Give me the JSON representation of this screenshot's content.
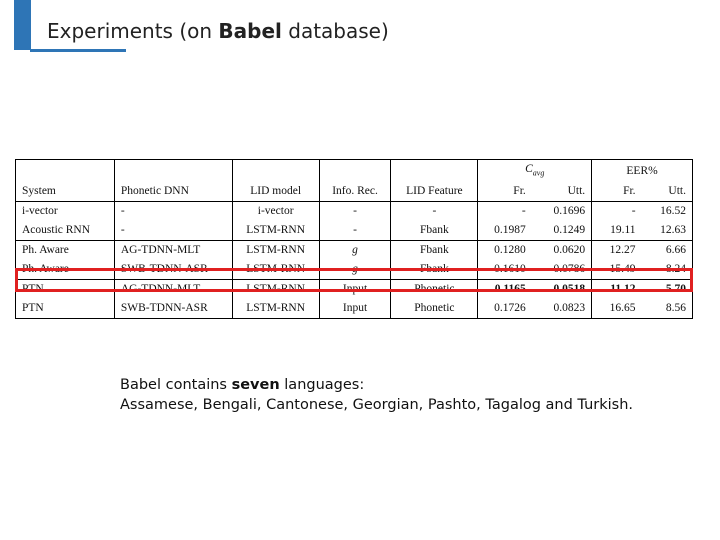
{
  "title": {
    "prefix": "Experiments (on ",
    "bold": "Babel",
    "suffix": " database)"
  },
  "colors": {
    "accent": "#2e75b6",
    "highlight": "#e02020"
  },
  "table": {
    "group_headers": {
      "cavg": "C",
      "cavg_sub": "avg",
      "eer": "EER%"
    },
    "headers": [
      "System",
      "Phonetic DNN",
      "LID model",
      "Info. Rec.",
      "LID Feature",
      "Fr.",
      "Utt.",
      "Fr.",
      "Utt."
    ],
    "rows": [
      [
        "i-vector",
        "-",
        "i-vector",
        "-",
        "-",
        "-",
        "0.1696",
        "-",
        "16.52"
      ],
      [
        "Acoustic RNN",
        "-",
        "LSTM-RNN",
        "-",
        "Fbank",
        "0.1987",
        "0.1249",
        "19.11",
        "12.63"
      ],
      [
        "Ph. Aware",
        "AG-TDNN-MLT",
        "LSTM-RNN",
        "g",
        "Fbank",
        "0.1280",
        "0.0620",
        "12.27",
        "6.66"
      ],
      [
        "Ph. Aware",
        "SWB-TDNN-ASR",
        "LSTM-RNN",
        "g",
        "Fbank",
        "0.1610",
        "0.0786",
        "15.49",
        "8.24"
      ],
      [
        "PTN",
        "AG-TDNN-MLT",
        "LSTM-RNN",
        "Input",
        "Phonetic",
        "0.1165",
        "0.0518",
        "11.12",
        "5.70"
      ],
      [
        "PTN",
        "SWB-TDNN-ASR",
        "LSTM-RNN",
        "Input",
        "Phonetic",
        "0.1726",
        "0.0823",
        "16.65",
        "8.56"
      ]
    ]
  },
  "note": {
    "line1_prefix": "Babel contains ",
    "line1_bold": "seven",
    "line1_suffix": " languages:",
    "line2": "Assamese, Bengali, Cantonese, Georgian, Pashto, Tagalog and Turkish."
  }
}
